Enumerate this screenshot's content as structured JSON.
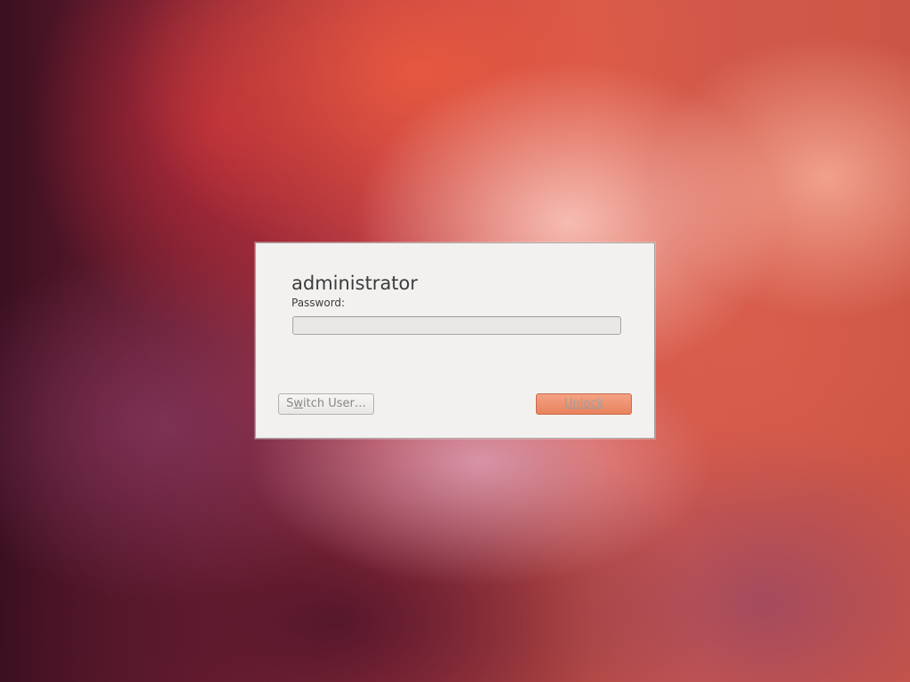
{
  "lock_dialog": {
    "username": "administrator",
    "password_label": "Password:",
    "password_value": "",
    "switch_user_button": {
      "prefix": "S",
      "mnemonic": "w",
      "suffix": "itch User…"
    },
    "unlock_button": "Unlock"
  },
  "colors": {
    "dialog_background": "#f2f1f0",
    "accent": "#e9825d",
    "wallpaper_primary": "#b83a45"
  }
}
